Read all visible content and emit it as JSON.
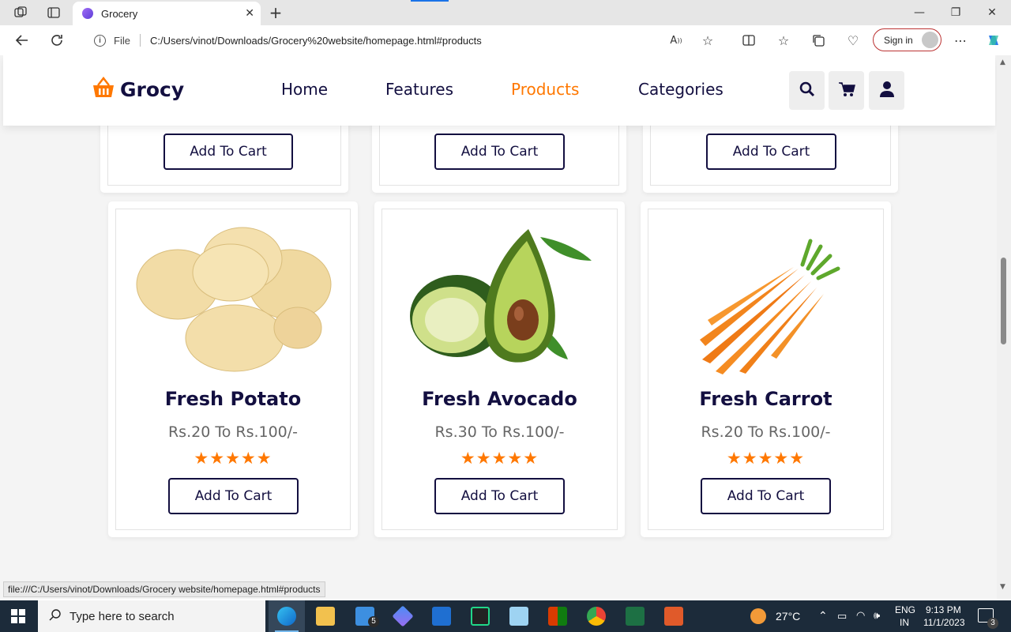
{
  "browser": {
    "tab_title": "Grocery",
    "address_label": "File",
    "url": "C:/Users/vinot/Downloads/Grocery%20website/homepage.html#products",
    "signin_label": "Sign in",
    "status_url": "file:///C:/Users/vinot/Downloads/Grocery website/homepage.html#products"
  },
  "site": {
    "logo": "Grocy",
    "nav": [
      "Home",
      "Features",
      "Products",
      "Categories"
    ],
    "active_nav": "Products",
    "accent_color": "#ff7800",
    "dark_color": "#130f40"
  },
  "top_row": {
    "buttons": [
      "Add To Cart",
      "Add To Cart",
      "Add To Cart"
    ]
  },
  "products": [
    {
      "name": "Fresh Potato",
      "price": "Rs.20 To Rs.100/-",
      "rating": 5,
      "button": "Add To Cart",
      "image": "potato"
    },
    {
      "name": "Fresh Avocado",
      "price": "Rs.30 To Rs.100/-",
      "rating": 5,
      "button": "Add To Cart",
      "image": "avocado"
    },
    {
      "name": "Fresh Carrot",
      "price": "Rs.20 To Rs.100/-",
      "rating": 5,
      "button": "Add To Cart",
      "image": "carrot"
    }
  ],
  "taskbar": {
    "search_placeholder": "Type here to search",
    "weather": "27°C",
    "lang_top": "ENG",
    "lang_bottom": "IN",
    "time": "9:13 PM",
    "date": "11/1/2023",
    "mail_badge": "5",
    "notif_count": "3"
  }
}
